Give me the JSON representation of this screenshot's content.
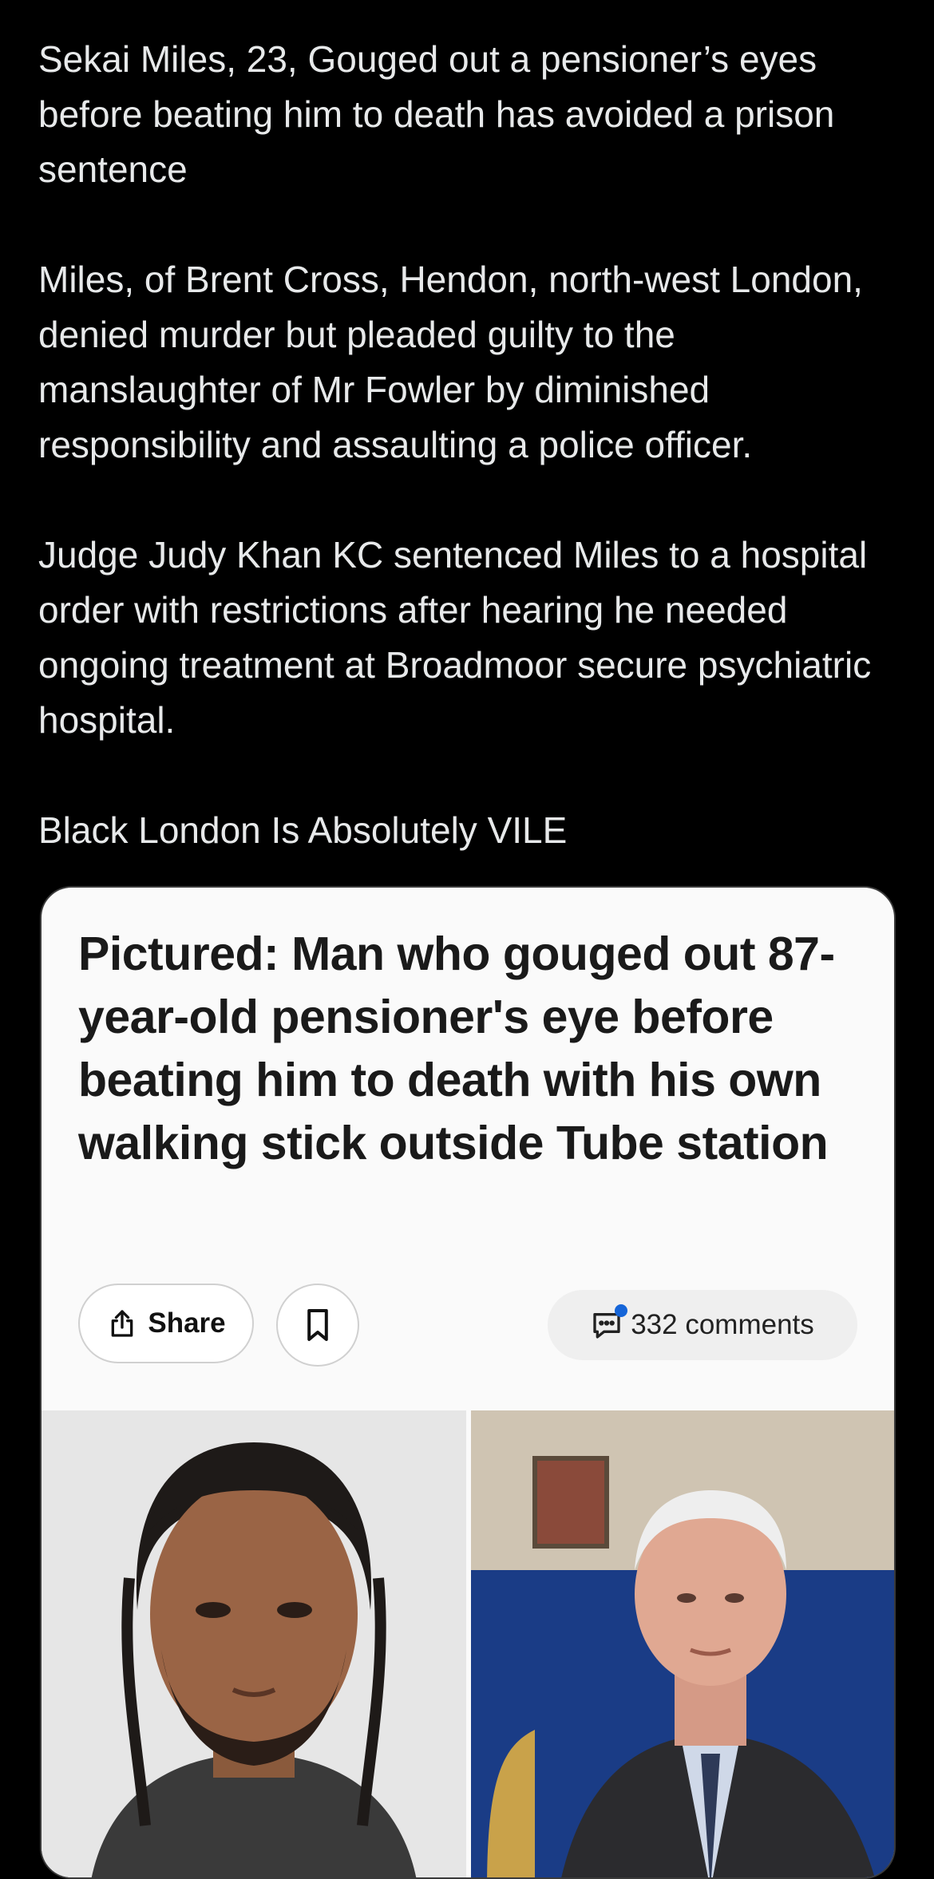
{
  "post": {
    "paragraphs": [
      "Sekai Miles, 23, Gouged out a pensioner’s eyes before beating him to death has avoided a prison sentence",
      "Miles, of Brent Cross, Hendon, north-west London, denied murder but pleaded guilty to the manslaughter of Mr Fowler by diminished responsibility and assaulting a police officer.",
      "Judge Judy Khan KC sentenced Miles to a hospital order with restrictions after hearing he needed ongoing treatment at Broadmoor secure psychiatric hospital.",
      "Black London Is Absolutely VILE"
    ]
  },
  "card": {
    "headline": "Pictured: Man who gouged out 87-year-old pensioner's eye before beating him to death with his own walking stick outside Tube station",
    "share_label": "Share",
    "comments_label": "332 comments",
    "icons": {
      "share": "share-icon",
      "bookmark": "bookmark-icon",
      "comments": "comment-bubble-icon"
    },
    "photos": [
      "mugshot-photo",
      "elderly-man-photo"
    ]
  },
  "colors": {
    "background": "#000000",
    "text": "#e7e9ea",
    "card_bg": "#fafafa",
    "headline": "#1a1a1a",
    "accent_dot": "#1565d8"
  }
}
